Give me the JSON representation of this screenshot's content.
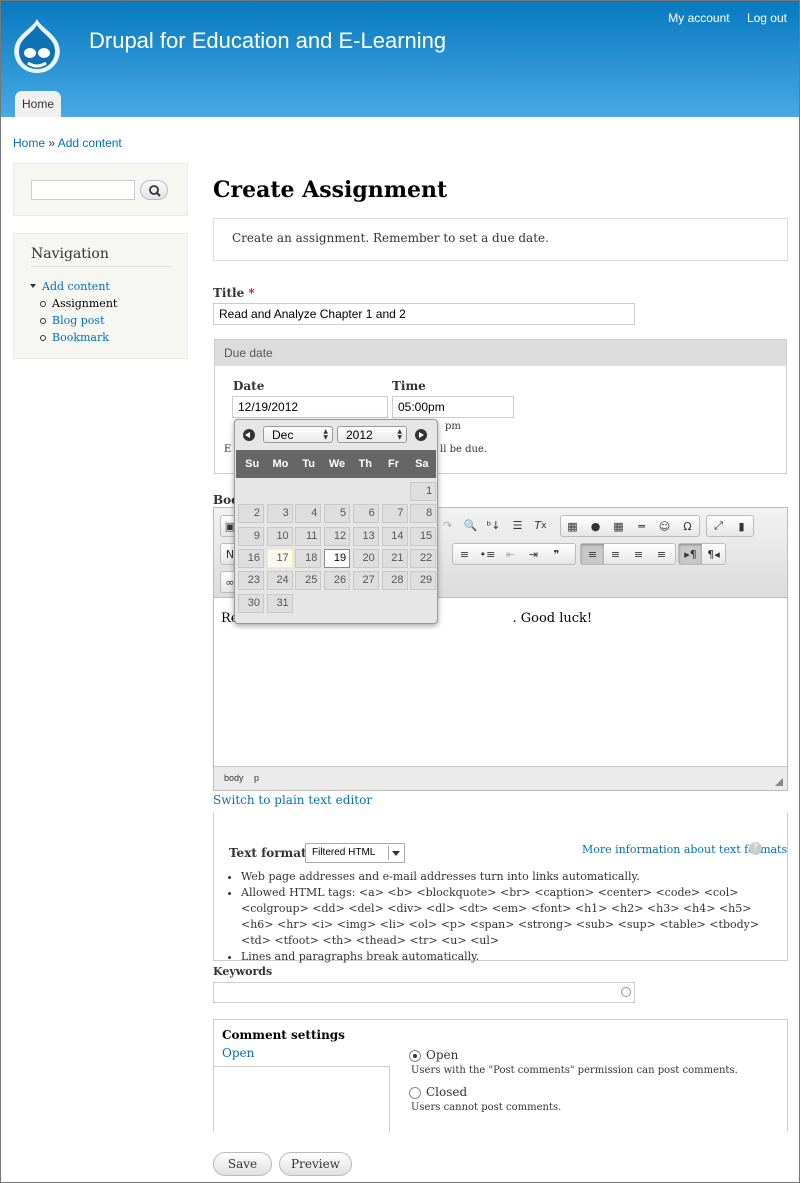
{
  "site": {
    "name": "Drupal for Education and E-Learning",
    "tab": "Home"
  },
  "secondary_menu": [
    "My account",
    "Log out"
  ],
  "breadcrumb": {
    "home": "Home",
    "separator": "»",
    "current": "Add content"
  },
  "navigation": {
    "title": "Navigation",
    "parent": "Add content",
    "children": [
      "Assignment",
      "Blog post",
      "Bookmark"
    ]
  },
  "page": {
    "title": "Create Assignment",
    "help": "Create an assignment. Remember to set a due date."
  },
  "title_field": {
    "label": "Title",
    "required_marker": "*",
    "value": "Read and Analyze Chapter 1 and 2"
  },
  "due_date": {
    "legend": "Due date",
    "date_label": "Date",
    "date_value": "12/19/2012",
    "time_label": "Time",
    "time_value": "05:00pm",
    "time_hint_fragment": "pm",
    "desc_start": "E",
    "desc_end": "ll be due."
  },
  "datepicker": {
    "month": "Dec",
    "year": "2012",
    "weekdays": [
      "Su",
      "Mo",
      "Tu",
      "We",
      "Th",
      "Fr",
      "Sa"
    ],
    "days": [
      "1",
      "2",
      "3",
      "4",
      "5",
      "6",
      "7",
      "8",
      "9",
      "10",
      "11",
      "12",
      "13",
      "14",
      "15",
      "16",
      "17",
      "18",
      "19",
      "20",
      "21",
      "22",
      "23",
      "24",
      "25",
      "26",
      "27",
      "28",
      "29",
      "30",
      "31"
    ],
    "first_weekday": 6,
    "today": "17",
    "selected": "19"
  },
  "body_field": {
    "label_fragment": "Bod",
    "text_left": "Re",
    "text_right": ". Good luck!",
    "path": [
      "body",
      "p"
    ],
    "toolbar_row1": [
      "search-icon",
      "replace-icon",
      "paste-word-icon",
      "remove-format-icon",
      "image-icon",
      "flash-icon",
      "table-icon",
      "horizontal-rule-icon",
      "smiley-icon",
      "special-char-icon",
      "maximize-icon",
      "show-blocks-icon"
    ],
    "toolbar_row2": [
      "numbered-list-icon",
      "bulleted-list-icon",
      "outdent-icon",
      "indent-icon",
      "blockquote-icon",
      "align-left-icon",
      "align-center-icon",
      "align-right-icon",
      "justify-icon",
      "ltr-icon",
      "rtl-icon"
    ]
  },
  "switch_link": "Switch to plain text editor",
  "text_format": {
    "label": "Text format",
    "selected": "Filtered HTML",
    "more_info": "More information about text formats",
    "tips": [
      "Web page addresses and e-mail addresses turn into links automatically.",
      "Allowed HTML tags: <a> <b> <blockquote> <br> <caption> <center> <code> <col> <colgroup> <dd> <del> <div> <dl> <dt> <em> <font> <h1> <h2> <h3> <h4> <h5> <h6> <hr> <i> <img> <li> <ol> <p> <span> <strong> <sub> <sup> <table> <tbody> <td> <tfoot> <th> <thead> <tr> <u> <ul>",
      "Lines and paragraphs break automatically."
    ]
  },
  "keywords": {
    "label": "Keywords",
    "value": ""
  },
  "comment_settings": {
    "title": "Comment settings",
    "summary": "Open",
    "options": [
      {
        "label": "Open",
        "desc": "Users with the \"Post comments\" permission can post comments.",
        "checked": true
      },
      {
        "label": "Closed",
        "desc": "Users cannot post comments.",
        "checked": false
      }
    ]
  },
  "actions": {
    "save": "Save",
    "preview": "Preview"
  },
  "colors": {
    "header_top": "#0779bf",
    "header_bottom": "#48a9e4",
    "link": "#0071b3"
  }
}
